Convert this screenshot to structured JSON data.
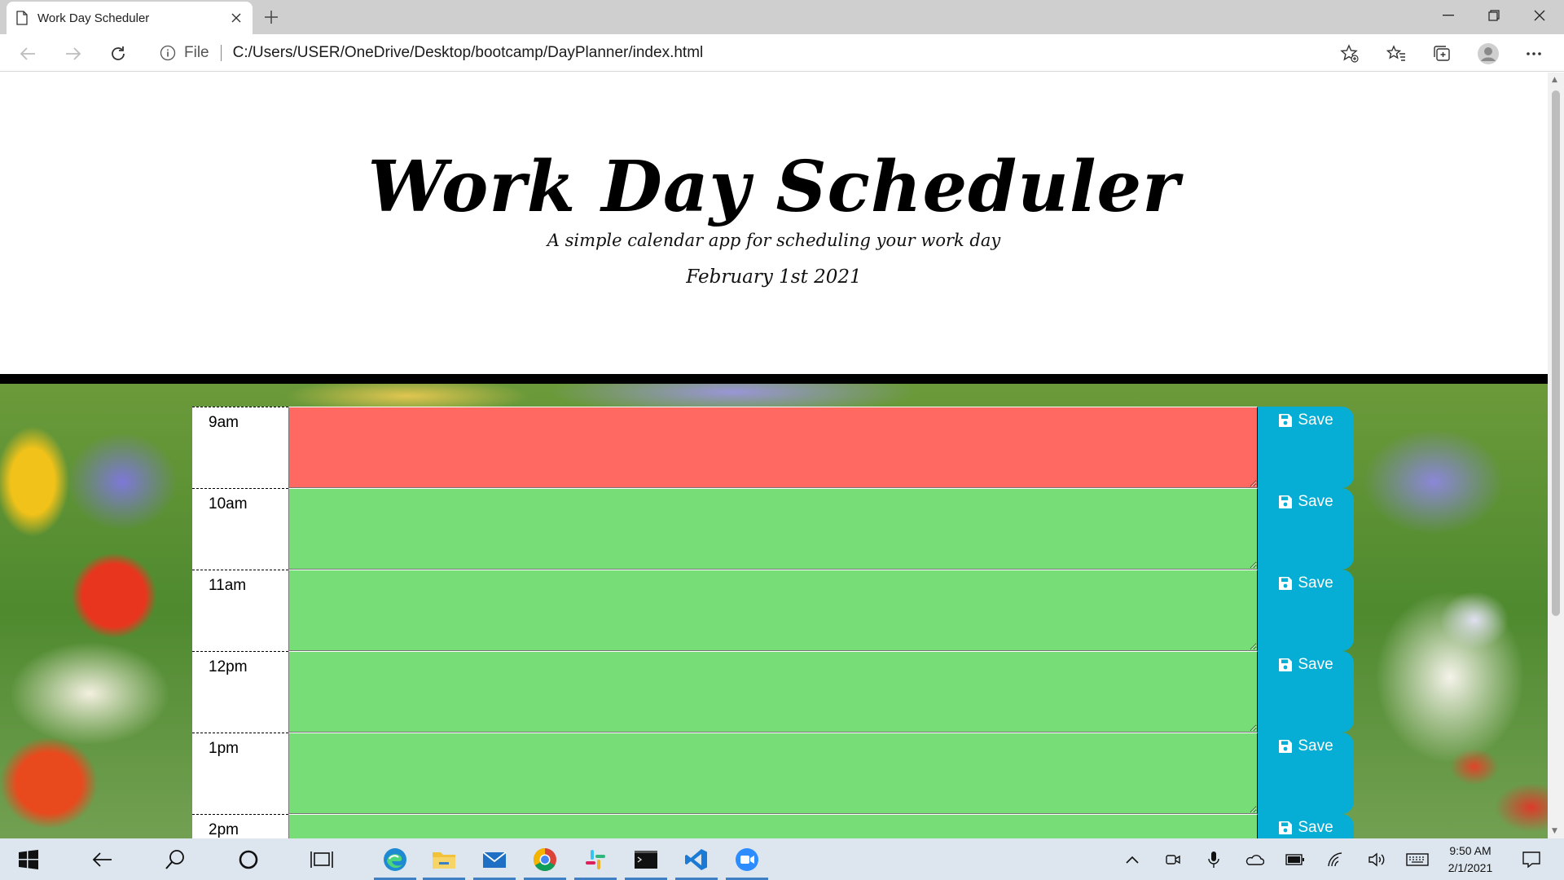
{
  "browser": {
    "tab_title": "Work Day Scheduler",
    "address_prefix": "File",
    "url": "C:/Users/USER/OneDrive/Desktop/bootcamp/DayPlanner/index.html"
  },
  "page": {
    "title": "Work Day Scheduler",
    "lead": "A simple calendar app for scheduling your work day",
    "current_day": "February 1st 2021",
    "save_label": "Save",
    "hours": [
      {
        "label": "9am",
        "state": "present"
      },
      {
        "label": "10am",
        "state": "future"
      },
      {
        "label": "11am",
        "state": "future"
      },
      {
        "label": "12pm",
        "state": "future"
      },
      {
        "label": "1pm",
        "state": "future"
      },
      {
        "label": "2pm",
        "state": "future"
      }
    ],
    "colors": {
      "past": "#d3d3d3",
      "present": "#ff6961",
      "future": "#77dd77",
      "save": "#06aed5"
    }
  },
  "taskbar": {
    "time": "9:50 AM",
    "date": "2/1/2021",
    "apps": [
      "start-icon",
      "back-icon",
      "search-icon",
      "cortana-icon",
      "task-view-icon",
      "edge-icon",
      "file-explorer-icon",
      "mail-icon",
      "chrome-icon",
      "slack-icon",
      "terminal-icon",
      "vscode-icon",
      "zoom-icon"
    ]
  }
}
